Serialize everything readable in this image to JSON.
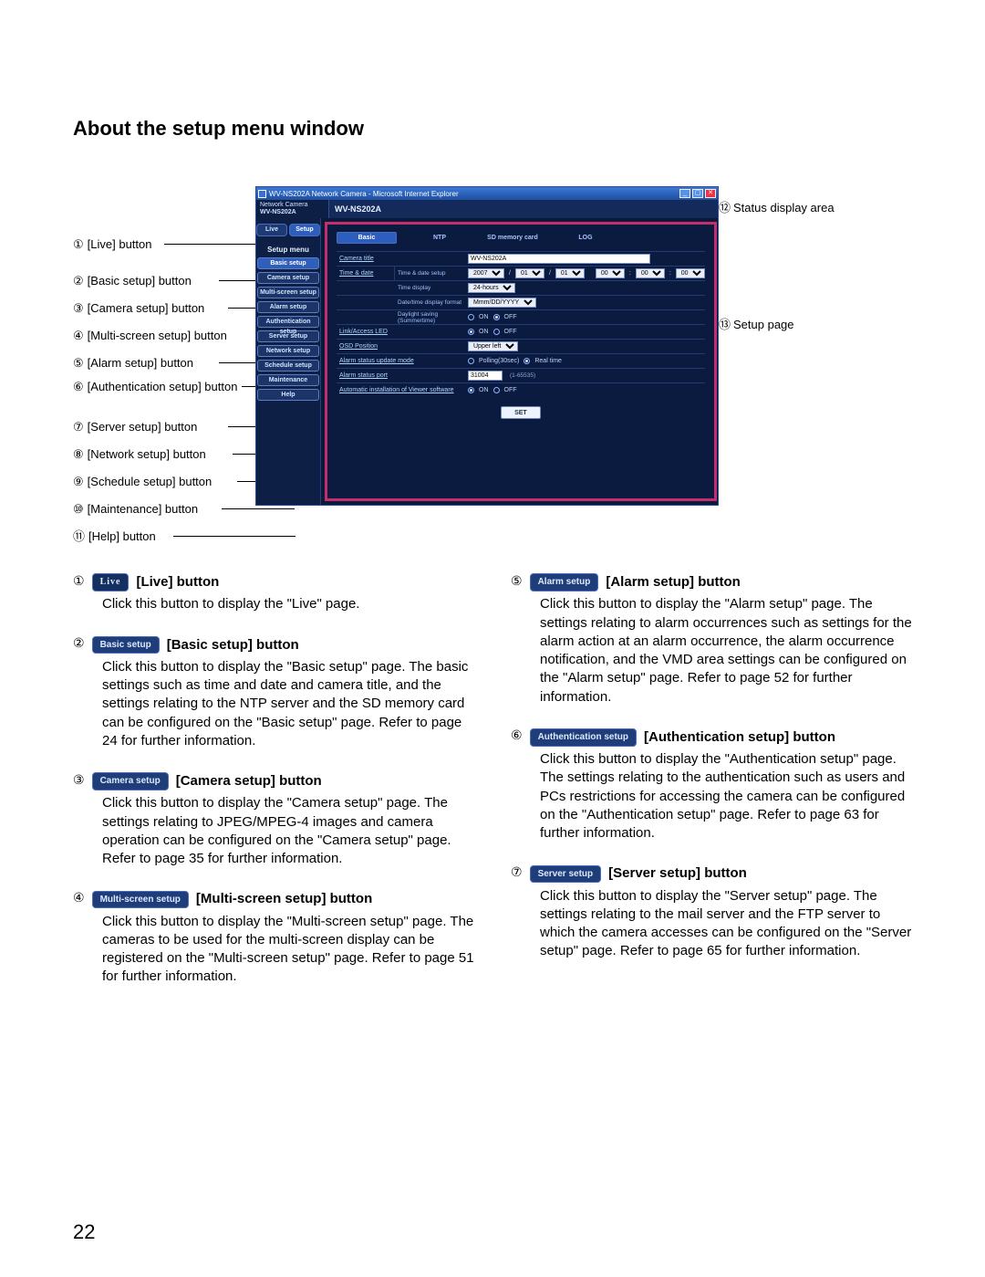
{
  "page": {
    "title": "About the setup menu window",
    "number": "22"
  },
  "labels_left": [
    {
      "n": "①",
      "t": "[Live] button"
    },
    {
      "n": "②",
      "t": "[Basic setup] button"
    },
    {
      "n": "③",
      "t": "[Camera setup] button"
    },
    {
      "n": "④",
      "t": "[Multi-screen setup] button"
    },
    {
      "n": "⑤",
      "t": "[Alarm setup] button"
    },
    {
      "n": "⑥",
      "t": "[Authentication setup] button"
    },
    {
      "n": "⑦",
      "t": "[Server setup] button"
    },
    {
      "n": "⑧",
      "t": "[Network setup] button"
    },
    {
      "n": "⑨",
      "t": "[Schedule setup] button"
    },
    {
      "n": "⑩",
      "t": "[Maintenance] button"
    },
    {
      "n": "⑪",
      "t": "[Help] button"
    }
  ],
  "labels_right": [
    {
      "n": "⑫",
      "t": "Status display area"
    },
    {
      "n": "⑬",
      "t": "Setup page"
    }
  ],
  "ie": {
    "title": "WV-NS202A Network Camera - Microsoft Internet Explorer",
    "brand_small_top": "Network Camera",
    "brand_small_bottom": "WV-NS202A",
    "brand_right": "WV-NS202A",
    "tabs": {
      "live": "Live",
      "setup": "Setup"
    },
    "menu_title": "Setup menu",
    "menu": [
      {
        "k": "basic",
        "t": "Basic setup"
      },
      {
        "k": "camera",
        "t": "Camera setup"
      },
      {
        "k": "multi",
        "t": "Multi-screen setup"
      },
      {
        "k": "alarm",
        "t": "Alarm setup"
      },
      {
        "k": "auth",
        "t": "Authentication setup"
      },
      {
        "k": "server",
        "t": "Server setup"
      },
      {
        "k": "network",
        "t": "Network setup"
      },
      {
        "k": "schedule",
        "t": "Schedule setup"
      },
      {
        "k": "maint",
        "t": "Maintenance"
      },
      {
        "k": "help",
        "t": "Help"
      }
    ],
    "top_tabs": [
      "Basic",
      "NTP",
      "SD memory card",
      "LOG"
    ],
    "rows": {
      "camera_title": {
        "label": "Camera title",
        "value": "WV-NS202A"
      },
      "time_date_group": "Time & date",
      "td1": {
        "label": "Time & date setup",
        "year": "2007",
        "slash": "/",
        "mon": "01",
        "day": "01",
        "hh": "00",
        "mm": "00",
        "ss": "00"
      },
      "td2": {
        "label": "Time display",
        "value": "24-hours"
      },
      "td3": {
        "label": "Date/time display format",
        "value": "Mmm/DD/YYYY"
      },
      "td4": {
        "label": "Daylight saving (Summertime)",
        "on": "ON",
        "off": "OFF"
      },
      "linkled": {
        "label": "Link/Access LED",
        "on": "ON",
        "off": "OFF"
      },
      "osd": {
        "label": "OSD Position",
        "value": "Upper left"
      },
      "alarmmode": {
        "label": "Alarm status update mode",
        "poll": "Polling(30sec)",
        "real": "Real time"
      },
      "alarmport": {
        "label": "Alarm status port",
        "value": "31004",
        "hint": "(1-65535)"
      },
      "viewer": {
        "label": "Automatic installation of Viewer software",
        "on": "ON",
        "off": "OFF"
      },
      "set": "SET"
    }
  },
  "desc": [
    {
      "n": "①",
      "pill": "Live",
      "pill_class": "live",
      "bold": "[Live] button",
      "body": "Click this button to display the \"Live\" page."
    },
    {
      "n": "②",
      "pill": "Basic setup",
      "bold": "[Basic setup] button",
      "body": "Click this button to display the \"Basic setup\" page. The basic settings such as time and date and camera title, and the settings relating to the NTP server and the SD memory card can be configured on the \"Basic setup\" page. Refer to page 24 for further information."
    },
    {
      "n": "③",
      "pill": "Camera setup",
      "bold": "[Camera setup] button",
      "body": "Click this button to display the \"Camera setup\" page. The settings relating to JPEG/MPEG-4 images and camera operation can be configured on the \"Camera setup\" page. Refer to page 35 for further information."
    },
    {
      "n": "④",
      "pill": "Multi-screen setup",
      "bold": "[Multi-screen setup] button",
      "body": "Click this button to display the \"Multi-screen setup\" page. The cameras to be used for the multi-screen display can be registered on the \"Multi-screen setup\" page. Refer to page 51 for further information."
    },
    {
      "n": "⑤",
      "pill": "Alarm setup",
      "bold": "[Alarm setup] button",
      "body": "Click this button to display the \"Alarm setup\" page. The settings relating to alarm occurrences such as settings for the alarm action at an alarm occurrence, the alarm occurrence notification, and the VMD area settings can be configured on the \"Alarm setup\" page. Refer to page 52 for further information."
    },
    {
      "n": "⑥",
      "pill": "Authentication setup",
      "bold": "[Authentication setup] button",
      "body": "Click this button to display the \"Authentication setup\" page. The settings relating to the authentication such as users and PCs restrictions for accessing the camera can be configured on the \"Authentication setup\" page. Refer to page 63 for further information."
    },
    {
      "n": "⑦",
      "pill": "Server setup",
      "bold": "[Server setup] button",
      "body": "Click this button to display the \"Server setup\" page. The settings relating to the mail server and the FTP server to which the camera accesses can be configured on the \"Server setup\" page. Refer to page 65 for further information."
    }
  ]
}
